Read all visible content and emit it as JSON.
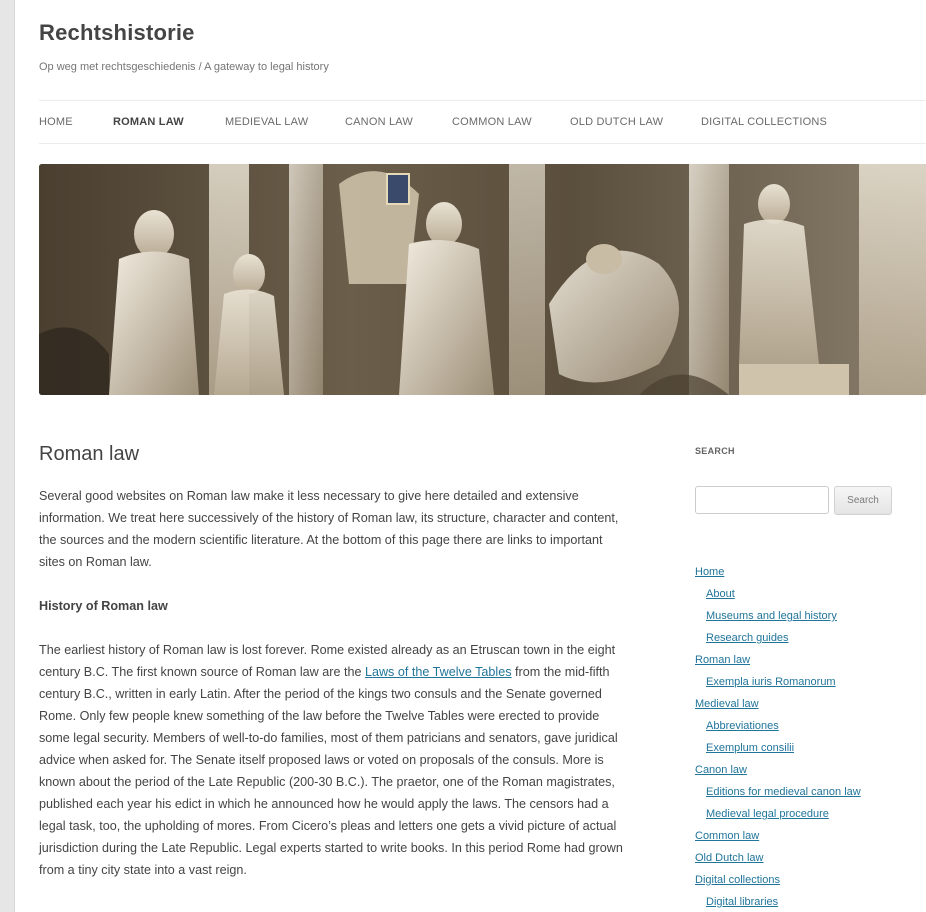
{
  "site": {
    "title": "Rechtshistorie",
    "description": "Op weg met rechtsgeschiedenis / A gateway to legal history"
  },
  "nav": {
    "items": [
      {
        "label": "HOME"
      },
      {
        "label": "ROMAN LAW",
        "active": true
      },
      {
        "label": "MEDIEVAL LAW"
      },
      {
        "label": "CANON LAW"
      },
      {
        "label": "COMMON LAW"
      },
      {
        "label": "OLD DUTCH LAW"
      },
      {
        "label": "DIGITAL COLLECTIONS"
      }
    ]
  },
  "main": {
    "title": "Roman law",
    "intro": "Several good websites on Roman law make it less necessary to give here detailed and extensive information. We treat here successively of the history of Roman law, its structure, character and content, the sources and the modern scientific literature. At the bottom of this page there are links to important sites on Roman law.",
    "section_heading": "History of Roman law",
    "para_before_link": "The earliest history of Roman law is lost forever. Rome existed already as an Etruscan town in the eight century B.C. The first known source of Roman law are the ",
    "link_text": "Laws of the Twelve Tables",
    "para_after_link": " from the mid-fifth century B.C., written in early Latin. After the period of the kings two consuls and the Senate governed Rome. Only few people knew something of the law before the Twelve Tables were erected to provide some legal security. Members of well-to-do families, most of them patricians and senators, gave juridical advice when asked for. The Senate itself proposed laws or voted on proposals of the consuls. More is known about the period of the Late Republic (200-30 B.C.). The praetor, one of the Roman magistrates, published each year his edict in which he announced how he would apply the laws. The censors had a legal task, too, the upholding of mores. From Cicero’s pleas and letters one gets a vivid picture of actual jurisdiction during the Late Republic. Legal experts started to write books. In this period Rome had grown from a tiny city state into a vast reign."
  },
  "sidebar": {
    "search_title": "SEARCH",
    "search_value": "",
    "search_button": "Search",
    "pages": [
      {
        "label": "Home",
        "child": false
      },
      {
        "label": "About",
        "child": true
      },
      {
        "label": "Museums and legal history",
        "child": true
      },
      {
        "label": "Research guides",
        "child": true
      },
      {
        "label": "Roman law",
        "child": false
      },
      {
        "label": "Exempla iuris Romanorum",
        "child": true
      },
      {
        "label": "Medieval law",
        "child": false
      },
      {
        "label": "Abbreviationes",
        "child": true
      },
      {
        "label": "Exemplum consilii",
        "child": true
      },
      {
        "label": "Canon law",
        "child": false
      },
      {
        "label": "Editions for medieval canon law",
        "child": true
      },
      {
        "label": "Medieval legal procedure",
        "child": true
      },
      {
        "label": "Common law",
        "child": false
      },
      {
        "label": "Old Dutch law",
        "child": false
      },
      {
        "label": "Digital collections",
        "child": false
      },
      {
        "label": "Digital libraries",
        "child": true
      }
    ]
  },
  "colors": {
    "link": "#21759b",
    "text": "#444444",
    "muted": "#757575"
  }
}
